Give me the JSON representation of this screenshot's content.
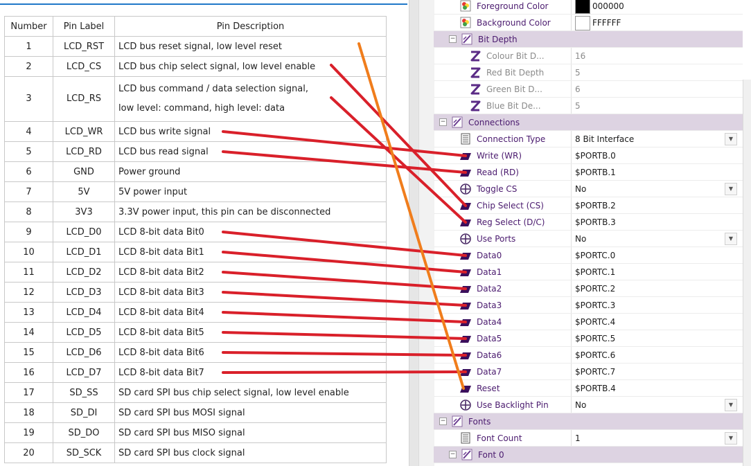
{
  "pin_table": {
    "headers": [
      "Number",
      "Pin Label",
      "Pin Description"
    ],
    "rows": [
      {
        "number": "1",
        "label": "LCD_RST",
        "desc": "LCD bus reset signal, low level reset"
      },
      {
        "number": "2",
        "label": "LCD_CS",
        "desc": "LCD bus chip select signal, low level enable"
      },
      {
        "number": "3",
        "label": "LCD_RS",
        "desc": "LCD bus command / data selection signal,",
        "desc2": "low level: command, high level: data"
      },
      {
        "number": "4",
        "label": "LCD_WR",
        "desc": "LCD bus write signal"
      },
      {
        "number": "5",
        "label": "LCD_RD",
        "desc": "LCD bus read signal"
      },
      {
        "number": "6",
        "label": "GND",
        "desc": "Power ground"
      },
      {
        "number": "7",
        "label": "5V",
        "desc": "5V power input"
      },
      {
        "number": "8",
        "label": "3V3",
        "desc": "3.3V power input, this pin can be disconnected"
      },
      {
        "number": "9",
        "label": "LCD_D0",
        "desc": "LCD 8-bit data Bit0"
      },
      {
        "number": "10",
        "label": "LCD_D1",
        "desc": "LCD 8-bit data Bit1"
      },
      {
        "number": "11",
        "label": "LCD_D2",
        "desc": "LCD 8-bit data Bit2"
      },
      {
        "number": "12",
        "label": "LCD_D3",
        "desc": "LCD 8-bit data Bit3"
      },
      {
        "number": "13",
        "label": "LCD_D4",
        "desc": "LCD 8-bit data Bit4"
      },
      {
        "number": "14",
        "label": "LCD_D5",
        "desc": "LCD 8-bit data Bit5"
      },
      {
        "number": "15",
        "label": "LCD_D6",
        "desc": "LCD 8-bit data Bit6"
      },
      {
        "number": "16",
        "label": "LCD_D7",
        "desc": "LCD 8-bit data Bit7"
      },
      {
        "number": "17",
        "label": "SD_SS",
        "desc": "SD card SPI bus chip select signal, low level enable"
      },
      {
        "number": "18",
        "label": "SD_DI",
        "desc": "SD card SPI bus MOSI signal"
      },
      {
        "number": "19",
        "label": "SD_DO",
        "desc": "SD card SPI bus MISO signal"
      },
      {
        "number": "20",
        "label": "SD_SCK",
        "desc": "SD card SPI bus clock signal"
      }
    ]
  },
  "properties": [
    {
      "id": "fg",
      "kind": "prop",
      "indent": 2,
      "icon": "palette-icon",
      "label": "Foreground Color",
      "value": "000000",
      "swatch": "#000000"
    },
    {
      "id": "bg",
      "kind": "prop",
      "indent": 2,
      "icon": "palette-icon",
      "label": "Background Color",
      "value": "FFFFFF",
      "swatch": "#ffffff"
    },
    {
      "id": "bitdepth",
      "kind": "group",
      "indent": 1,
      "icon": "group-icon",
      "label": "Bit Depth",
      "toggle": "−"
    },
    {
      "id": "colourbits",
      "kind": "prop",
      "indent": 3,
      "icon": "z-icon",
      "label": "Colour Bit D...",
      "value": "16",
      "disabled": true
    },
    {
      "id": "redbits",
      "kind": "prop",
      "indent": 3,
      "icon": "z-icon",
      "label": "Red Bit Depth",
      "value": "5",
      "disabled": true
    },
    {
      "id": "greenbits",
      "kind": "prop",
      "indent": 3,
      "icon": "z-icon",
      "label": "Green Bit D...",
      "value": "6",
      "disabled": true
    },
    {
      "id": "bluebits",
      "kind": "prop",
      "indent": 3,
      "icon": "z-icon",
      "label": "Blue Bit De...",
      "value": "5",
      "disabled": true
    },
    {
      "id": "connections",
      "kind": "group",
      "indent": 0,
      "icon": "group-icon",
      "label": "Connections",
      "toggle": "−"
    },
    {
      "id": "conntype",
      "kind": "prop",
      "indent": 2,
      "icon": "document-icon",
      "label": "Connection Type",
      "value": "8 Bit Interface",
      "dropdown": true
    },
    {
      "id": "wr",
      "kind": "prop",
      "indent": 2,
      "icon": "pin-icon",
      "label": "Write (WR)",
      "value": "$PORTB.0"
    },
    {
      "id": "rd",
      "kind": "prop",
      "indent": 2,
      "icon": "pin-icon",
      "label": "Read (RD)",
      "value": "$PORTB.1"
    },
    {
      "id": "togglecs",
      "kind": "prop",
      "indent": 2,
      "icon": "crosshair-icon",
      "label": "Toggle CS",
      "value": "No",
      "dropdown": true
    },
    {
      "id": "cs",
      "kind": "prop",
      "indent": 2,
      "icon": "pin-icon",
      "label": "Chip Select (CS)",
      "value": "$PORTB.2"
    },
    {
      "id": "dc",
      "kind": "prop",
      "indent": 2,
      "icon": "pin-icon",
      "label": "Reg Select (D/C)",
      "value": "$PORTB.3"
    },
    {
      "id": "useports",
      "kind": "prop",
      "indent": 2,
      "icon": "crosshair-icon",
      "label": "Use Ports",
      "value": "No",
      "dropdown": true
    },
    {
      "id": "d0",
      "kind": "prop",
      "indent": 2,
      "icon": "pin-icon",
      "label": "Data0",
      "value": "$PORTC.0"
    },
    {
      "id": "d1",
      "kind": "prop",
      "indent": 2,
      "icon": "pin-icon",
      "label": "Data1",
      "value": "$PORTC.1"
    },
    {
      "id": "d2",
      "kind": "prop",
      "indent": 2,
      "icon": "pin-icon",
      "label": "Data2",
      "value": "$PORTC.2"
    },
    {
      "id": "d3",
      "kind": "prop",
      "indent": 2,
      "icon": "pin-icon",
      "label": "Data3",
      "value": "$PORTC.3"
    },
    {
      "id": "d4",
      "kind": "prop",
      "indent": 2,
      "icon": "pin-icon",
      "label": "Data4",
      "value": "$PORTC.4"
    },
    {
      "id": "d5",
      "kind": "prop",
      "indent": 2,
      "icon": "pin-icon",
      "label": "Data5",
      "value": "$PORTC.5"
    },
    {
      "id": "d6",
      "kind": "prop",
      "indent": 2,
      "icon": "pin-icon",
      "label": "Data6",
      "value": "$PORTC.6"
    },
    {
      "id": "d7",
      "kind": "prop",
      "indent": 2,
      "icon": "pin-icon",
      "label": "Data7",
      "value": "$PORTC.7"
    },
    {
      "id": "reset",
      "kind": "prop",
      "indent": 2,
      "icon": "pin-icon",
      "label": "Reset",
      "value": "$PORTB.4"
    },
    {
      "id": "backlight",
      "kind": "prop",
      "indent": 2,
      "icon": "crosshair-icon",
      "label": "Use Backlight Pin",
      "value": "No",
      "dropdown": true
    },
    {
      "id": "fonts",
      "kind": "group",
      "indent": 0,
      "icon": "group-icon",
      "label": "Fonts",
      "toggle": "−"
    },
    {
      "id": "fontcount",
      "kind": "prop",
      "indent": 2,
      "icon": "document-icon",
      "label": "Font Count",
      "value": "1",
      "dropdown": true
    },
    {
      "id": "font0",
      "kind": "group",
      "indent": 1,
      "icon": "group-icon",
      "label": "Font 0",
      "toggle": "−"
    }
  ],
  "wire_mapping": {
    "red": [
      {
        "pin": "LCD_CS",
        "prop": "cs"
      },
      {
        "pin": "LCD_RS",
        "prop": "dc"
      },
      {
        "pin": "LCD_WR",
        "prop": "wr"
      },
      {
        "pin": "LCD_RD",
        "prop": "rd"
      },
      {
        "pin": "LCD_D0",
        "prop": "d0"
      },
      {
        "pin": "LCD_D1",
        "prop": "d1"
      },
      {
        "pin": "LCD_D2",
        "prop": "d2"
      },
      {
        "pin": "LCD_D3",
        "prop": "d3"
      },
      {
        "pin": "LCD_D4",
        "prop": "d4"
      },
      {
        "pin": "LCD_D5",
        "prop": "d5"
      },
      {
        "pin": "LCD_D6",
        "prop": "d6"
      },
      {
        "pin": "LCD_D7",
        "prop": "d7"
      }
    ],
    "orange": [
      {
        "pin": "LCD_RST",
        "prop": "reset"
      }
    ]
  },
  "colors": {
    "red_wire": "#d9202a",
    "orange_wire": "#f07d1c",
    "group_bg": "#ddd3e2",
    "label_text": "#4a1a6e",
    "pin_icon": "#3b0f5c"
  }
}
